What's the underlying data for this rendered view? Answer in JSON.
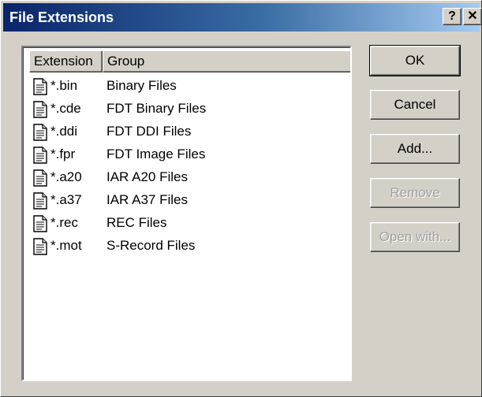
{
  "window": {
    "title": "File Extensions",
    "help_label": "?",
    "close_label": "✕"
  },
  "list": {
    "columns": [
      "Extension",
      "Group"
    ],
    "rows": [
      {
        "ext": "*.bin",
        "group": "Binary Files"
      },
      {
        "ext": "*.cde",
        "group": "FDT Binary Files"
      },
      {
        "ext": "*.ddi",
        "group": "FDT DDI Files"
      },
      {
        "ext": "*.fpr",
        "group": "FDT Image Files"
      },
      {
        "ext": "*.a20",
        "group": "IAR A20 Files"
      },
      {
        "ext": "*.a37",
        "group": "IAR A37 Files"
      },
      {
        "ext": "*.rec",
        "group": "REC Files"
      },
      {
        "ext": "*.mot",
        "group": "S-Record Files"
      }
    ],
    "row_icon": "document-icon"
  },
  "buttons": {
    "ok": "OK",
    "cancel": "Cancel",
    "add": "Add...",
    "remove": "Remove",
    "open_with": "Open with..."
  },
  "colors": {
    "title_start": "#0a246a",
    "title_end": "#a6caf0",
    "face": "#d4d0c8"
  }
}
